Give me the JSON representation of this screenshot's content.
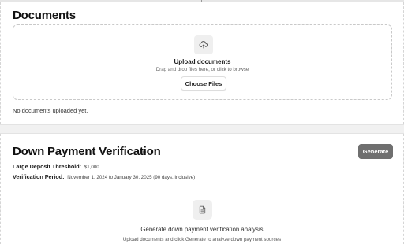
{
  "documents": {
    "title": "Documents",
    "upload_title": "Upload documents",
    "upload_subtitle": "Drag and drop files here, or click to browse",
    "choose_button": "Choose Files",
    "empty_text": "No documents uploaded yet."
  },
  "down_payment": {
    "title": "Down Payment Verification",
    "generate_button": "Generate",
    "threshold_label": "Large Deposit Threshold:",
    "threshold_value": "$1,000",
    "period_label": "Verification Period:",
    "period_value": "November 1, 2024 to January 30, 2025 (90 days, inclusive)",
    "empty_title": "Generate down payment verification analysis",
    "empty_subtitle": "Upload documents and click Generate to analyze down payment sources"
  },
  "icons": {
    "upload": "upload-cloud-icon",
    "settings": "gear-icon",
    "document": "document-icon"
  },
  "colors": {
    "generate_button_bg": "#6f6f6f",
    "icon_box_bg": "#efefef"
  }
}
